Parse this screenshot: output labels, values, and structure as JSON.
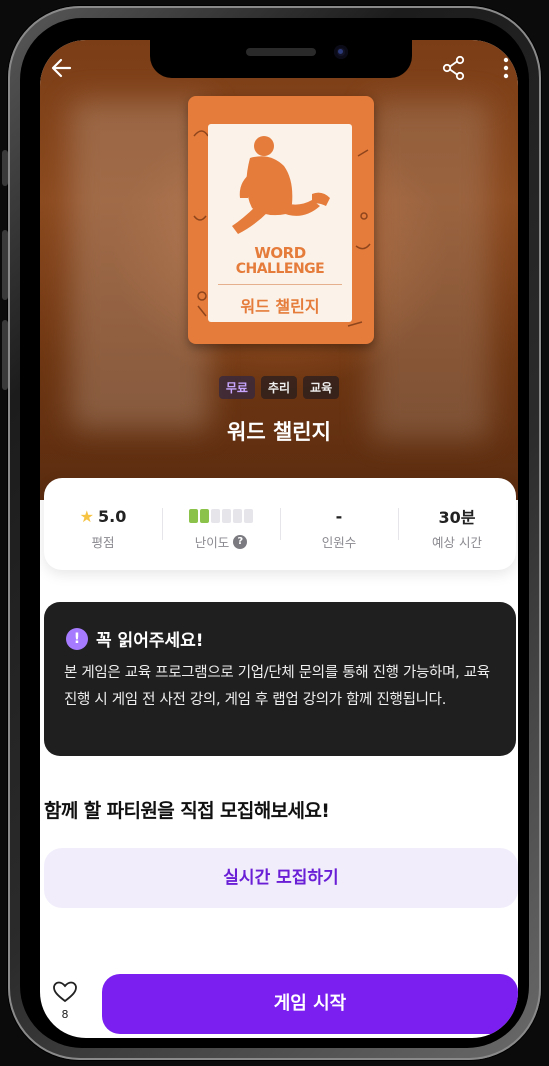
{
  "poster": {
    "title_line1": "WORD",
    "title_line2": "CHALLENGE",
    "subtitle": "워드 챌린지"
  },
  "tags": [
    "무료",
    "추리",
    "교육"
  ],
  "game_title": "워드 챌린지",
  "stats": {
    "rating_value": "5.0",
    "rating_label": "평점",
    "difficulty_level": 2,
    "difficulty_max": 6,
    "difficulty_label": "난이도",
    "players_value": "-",
    "players_label": "인원수",
    "time_value": "30분",
    "time_label": "예상 시간"
  },
  "notice": {
    "title": "꼭 읽어주세요!",
    "body": "본 게임은 교육 프로그램으로 기업/단체 문의를 통해 진행 가능하며, 교육 진행 시 게임 전 사전 강의, 게임 후 랩업 강의가 함께 진행됩니다."
  },
  "recruit": {
    "title": "함께 할 파티원을 직접 모집해보세요!",
    "button_label": "실시간 모집하기"
  },
  "bottom": {
    "like_count": "8",
    "start_label": "게임 시작"
  },
  "colors": {
    "accent": "#7a1ff0",
    "poster_orange": "#e57c3b",
    "notice_bg": "#1f1f1f"
  },
  "icons": [
    "back-arrow-icon",
    "share-icon",
    "more-vertical-icon",
    "star-icon",
    "help-icon",
    "alert-icon",
    "heart-icon"
  ]
}
